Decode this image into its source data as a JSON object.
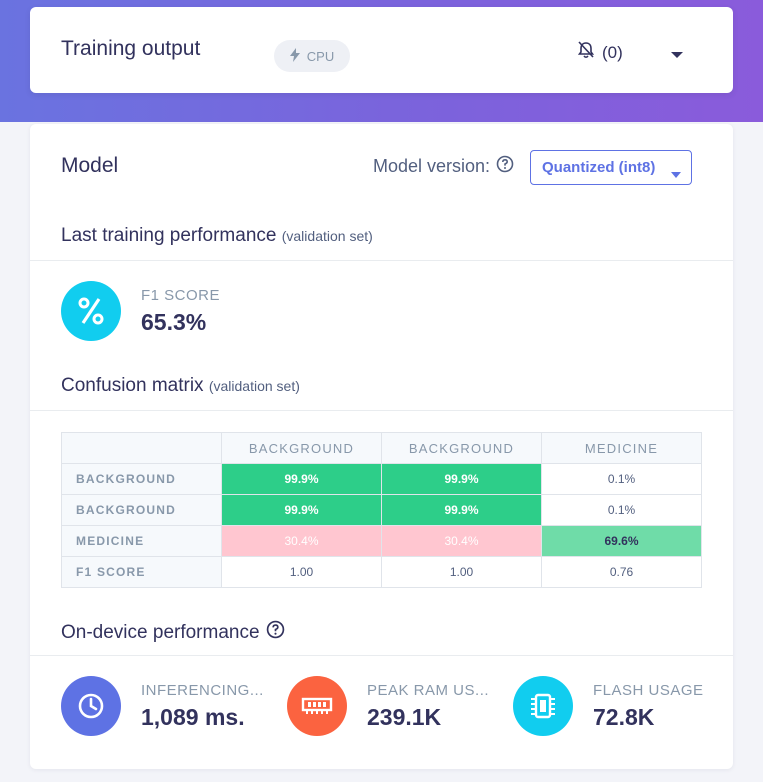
{
  "header": {
    "title": "Training output",
    "badge_label": "CPU",
    "notification_count": "(0)"
  },
  "model": {
    "title": "Model",
    "version_label": "Model version:",
    "version_selected": "Quantized (int8)"
  },
  "training": {
    "title": "Last training performance",
    "subtitle": "(validation set)",
    "f1_label": "F1 SCORE",
    "f1_value": "65.3%"
  },
  "confusion": {
    "title": "Confusion matrix",
    "subtitle": "(validation set)",
    "columns": [
      "BACKGROUND",
      "BACKGROUND",
      "MEDICINE"
    ],
    "rows": [
      {
        "label": "BACKGROUND",
        "cells": [
          "99.9%",
          "99.9%",
          "0.1%"
        ]
      },
      {
        "label": "BACKGROUND",
        "cells": [
          "99.9%",
          "99.9%",
          "0.1%"
        ]
      },
      {
        "label": "MEDICINE",
        "cells": [
          "30.4%",
          "30.4%",
          "69.6%"
        ]
      },
      {
        "label": "F1 SCORE",
        "cells": [
          "1.00",
          "1.00",
          "0.76"
        ]
      }
    ]
  },
  "device": {
    "title": "On-device performance",
    "metrics": [
      {
        "label": "INFERENCING...",
        "value": "1,089 ms.",
        "color": "#5e72e4",
        "icon": "clock-icon"
      },
      {
        "label": "PEAK RAM US...",
        "value": "239.1K",
        "color": "#fb6340",
        "icon": "ram-icon"
      },
      {
        "label": "FLASH USAGE",
        "value": "72.8K",
        "color": "#11cdef",
        "icon": "chip-icon"
      }
    ]
  },
  "colors": {
    "accent": "#5e72e4",
    "f1_circle": "#11cdef",
    "cell_high": "#2dce89",
    "cell_error": "#ffc6d0",
    "cell_mid": "#6fdca8"
  }
}
